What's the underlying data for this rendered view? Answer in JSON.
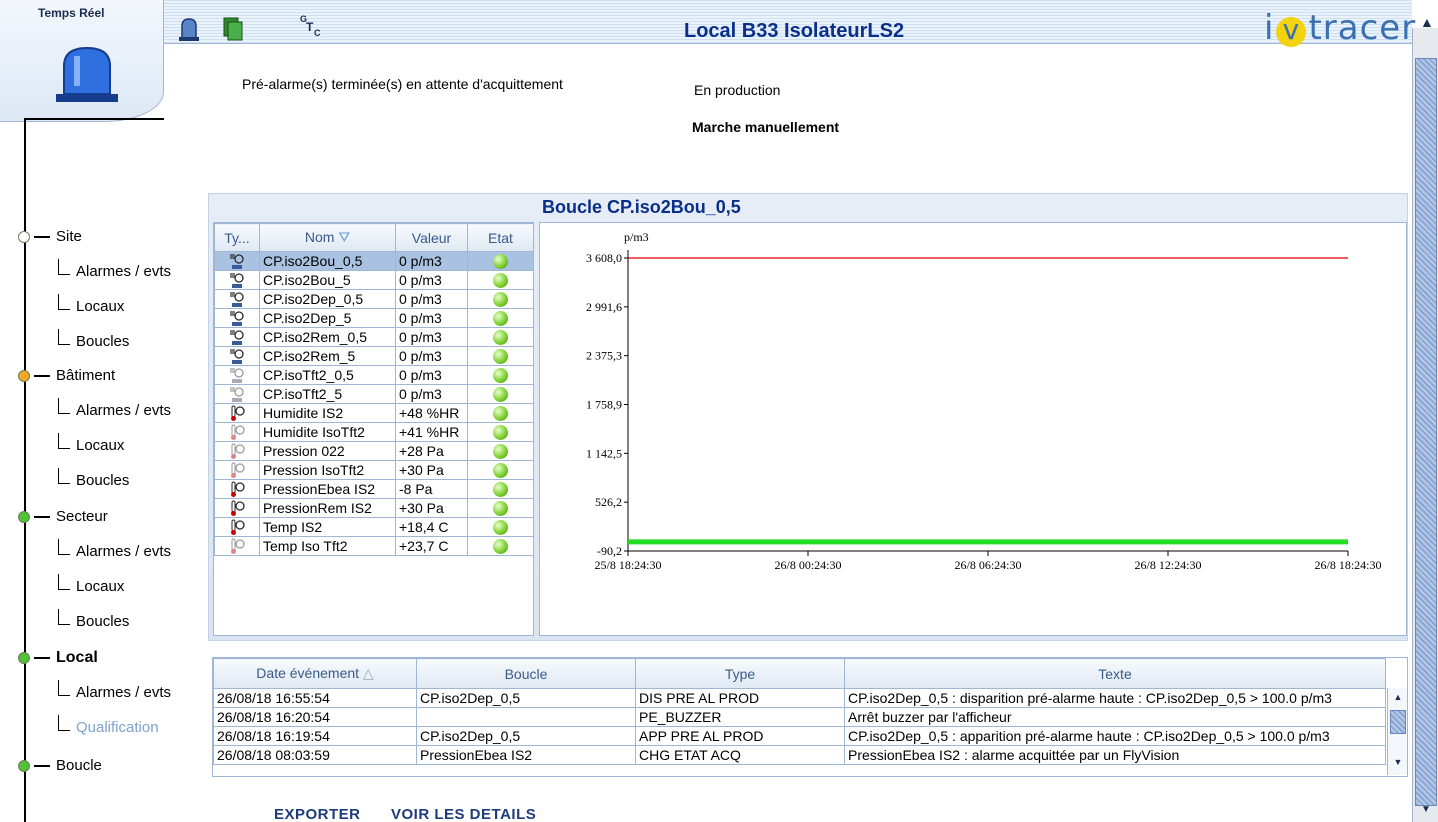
{
  "topbar": {
    "realtime_label": "Temps Réel",
    "title": "Local B33 IsolateurLS2",
    "logo_pre": "i",
    "logo_v": "v",
    "logo_post": "tracer",
    "gtc_g": "G",
    "gtc_t": "T",
    "gtc_c": "C",
    "icons": [
      "alarm-bell-icon",
      "documents-icon",
      "gtc-icon"
    ]
  },
  "status": {
    "alarm_message": "Pré-alarme(s) terminée(s) en attente d'acquittement",
    "production": "En production",
    "mode": "Marche manuellement"
  },
  "nav": [
    {
      "label": "Site",
      "dot": "#ffffff",
      "bold": false,
      "children": [
        "Alarmes / evts",
        "Locaux",
        "Boucles"
      ]
    },
    {
      "label": "Bâtiment",
      "dot": "#f5a623",
      "bold": false,
      "children": [
        "Alarmes / evts",
        "Locaux",
        "Boucles"
      ]
    },
    {
      "label": "Secteur",
      "dot": "#4fc235",
      "bold": false,
      "children": [
        "Alarmes / evts",
        "Locaux",
        "Boucles"
      ]
    },
    {
      "label": "Local",
      "dot": "#4fc235",
      "bold": true,
      "children": [
        "Alarmes / evts",
        "Qualification"
      ]
    },
    {
      "label": "Boucle",
      "dot": "#4fc235",
      "bold": false,
      "children": []
    }
  ],
  "loop": {
    "title": "Boucle CP.iso2Bou_0,5",
    "sensor_columns": [
      "Ty...",
      "Nom",
      "Valeur",
      "Etat"
    ],
    "sensors": [
      {
        "type": "particle",
        "name": "CP.iso2Bou_0,5",
        "value": "0 p/m3",
        "selected": true
      },
      {
        "type": "particle",
        "name": "CP.iso2Bou_5",
        "value": "0 p/m3"
      },
      {
        "type": "particle",
        "name": "CP.iso2Dep_0,5",
        "value": "0 p/m3"
      },
      {
        "type": "particle",
        "name": "CP.iso2Dep_5",
        "value": "0 p/m3"
      },
      {
        "type": "particle",
        "name": "CP.iso2Rem_0,5",
        "value": "0 p/m3"
      },
      {
        "type": "particle",
        "name": "CP.iso2Rem_5",
        "value": "0 p/m3"
      },
      {
        "type": "particle-gray",
        "name": "CP.isoTft2_0,5",
        "value": "0 p/m3"
      },
      {
        "type": "particle-gray",
        "name": "CP.isoTft2_5",
        "value": "0 p/m3"
      },
      {
        "type": "thermo",
        "name": "Humidite IS2",
        "value": "+48 %HR"
      },
      {
        "type": "thermo-gray",
        "name": "Humidite IsoTft2",
        "value": "+41 %HR"
      },
      {
        "type": "thermo-gray",
        "name": "Pression 022",
        "value": "+28 Pa"
      },
      {
        "type": "thermo-gray",
        "name": "Pression IsoTft2",
        "value": "+30 Pa"
      },
      {
        "type": "thermo",
        "name": "PressionEbea IS2",
        "value": "-8 Pa"
      },
      {
        "type": "thermo",
        "name": "PressionRem IS2",
        "value": "+30 Pa"
      },
      {
        "type": "thermo",
        "name": "Temp IS2",
        "value": "+18,4 C"
      },
      {
        "type": "thermo-gray",
        "name": "Temp Iso Tft2",
        "value": "+23,7 C"
      }
    ]
  },
  "chart_data": {
    "type": "line",
    "ylabel": "p/m3",
    "ylim": [
      -90.2,
      3608.0
    ],
    "yticks": [
      "3 608,0",
      "2 991,6",
      "2 375,3",
      "1 758,9",
      "1 142,5",
      "526,2",
      "-90,2"
    ],
    "xticks": [
      "25/8 18:24:30",
      "26/8 00:24:30",
      "26/8 06:24:30",
      "26/8 12:24:30",
      "26/8 18:24:30"
    ],
    "series": [
      {
        "color": "#e00000",
        "values": [
          3608.0,
          3608.0
        ]
      },
      {
        "color": "#22dd22",
        "values": [
          0,
          0
        ]
      }
    ]
  },
  "events": {
    "columns": [
      "Date événement",
      "Boucle",
      "Type",
      "Texte"
    ],
    "rows": [
      [
        "26/08/18 16:55:54",
        "CP.iso2Dep_0,5",
        "DIS PRE AL PROD",
        "CP.iso2Dep_0,5  : disparition pré-alarme haute : CP.iso2Dep_0,5  > 100.0 p/m3"
      ],
      [
        "26/08/18 16:20:54",
        "",
        "PE_BUZZER",
        "Arrêt buzzer par l'afficheur"
      ],
      [
        "26/08/18 16:19:54",
        "CP.iso2Dep_0,5",
        "APP PRE AL PROD",
        "CP.iso2Dep_0,5  : apparition pré-alarme haute : CP.iso2Dep_0,5  > 100.0 p/m3"
      ],
      [
        "26/08/18 08:03:59",
        "PressionEbea IS2",
        "CHG ETAT ACQ",
        "PressionEbea IS2 : alarme acquittée par un FlyVision"
      ]
    ]
  },
  "actions": {
    "export": "EXPORTER",
    "details": "VOIR LES DETAILS"
  }
}
